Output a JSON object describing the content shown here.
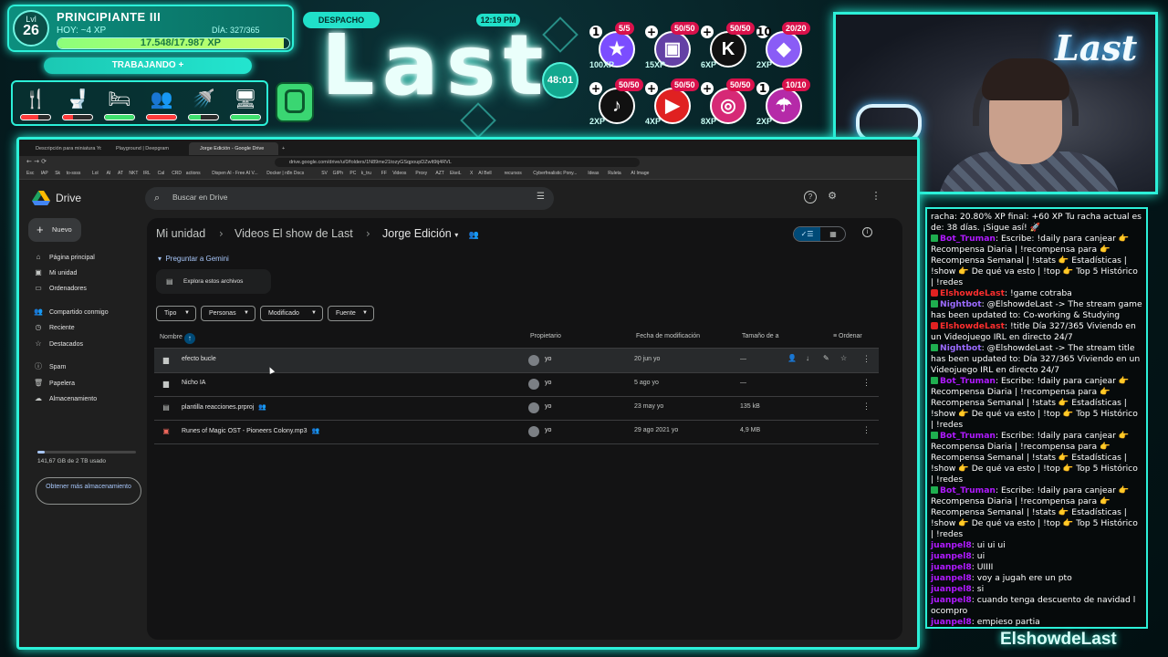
{
  "overlay": {
    "level": {
      "prefix": "Lvl",
      "number": "26",
      "title": "PRINCIPIANTE III",
      "today": "HOY: ~4 XP",
      "day": "DÍA: 327/365",
      "xp": "17.548/17.987 XP",
      "xp_fraction": 0.976
    },
    "status": "TRABAJANDO",
    "needs": [
      {
        "icon": "food-icon",
        "level": 0.6,
        "color": "#ff3b3b"
      },
      {
        "icon": "toilet-icon",
        "level": 0.35,
        "color": "#ff3b3b"
      },
      {
        "icon": "sleep-icon",
        "level": 1.0,
        "color": "#3fe06e"
      },
      {
        "icon": "social-icon",
        "level": 1.0,
        "color": "#ff3b3b"
      },
      {
        "icon": "shower-icon",
        "level": 0.4,
        "color": "#3fe06e"
      },
      {
        "icon": "fun-icon",
        "level": 1.0,
        "color": "#3fe06e"
      }
    ],
    "room": "DESPACHO",
    "clock": "12:19 PM",
    "logo_text": "Last",
    "timer": "48:01",
    "socials": [
      {
        "icon": "star-icon",
        "count": "5/5",
        "xp": "100XP",
        "pre": "1",
        "color": "#7b4dff"
      },
      {
        "icon": "twitch-icon",
        "count": "50/50",
        "xp": "15XP",
        "pre": "+",
        "color": "#6441a5"
      },
      {
        "icon": "kick-icon",
        "count": "50/50",
        "xp": "6XP",
        "pre": "+",
        "color": "#111"
      },
      {
        "icon": "ethereum-icon",
        "count": "20/20",
        "xp": "2XP",
        "pre": "10",
        "color": "#8a5cf6"
      },
      {
        "icon": "tiktok-icon",
        "count": "50/50",
        "xp": "2XP",
        "pre": "+",
        "color": "#111"
      },
      {
        "icon": "youtube-icon",
        "count": "50/50",
        "xp": "4XP",
        "pre": "+",
        "color": "#e02121"
      },
      {
        "icon": "instagram-icon",
        "count": "50/50",
        "xp": "8XP",
        "pre": "+",
        "color": "#d62976"
      },
      {
        "icon": "parachute-icon",
        "count": "10/10",
        "xp": "2XP",
        "pre": "1",
        "color": "#b52aa8"
      }
    ]
  },
  "browser": {
    "tabs": [
      "Descripción para miniatura YouTube",
      "Playground | Deepgram",
      "Jorge Edición - Google Drive"
    ],
    "url": "drive.google.com/drive/u/0/folders/1N89me21tozyGSqpoupDZwlt9tj4RVL",
    "bookmarks": [
      "Esc",
      "IAP",
      "Sk",
      "to-ssss",
      "Lol",
      "AI",
      "AT",
      "NKT",
      "IRL",
      "Cal",
      "CRD",
      "actions",
      "Dispen AI - Free AI V...",
      "Docker | n8n Docs",
      "SV",
      "GIPh",
      "PC",
      "k_tru",
      "FF",
      "Videos",
      "Proxy",
      "AZT",
      "EkeiL",
      "X",
      "AI Bell",
      "recursos",
      "Cyberfrealistic Pony...",
      "Ideas",
      "Ruleta",
      "AI Image"
    ]
  },
  "drive": {
    "app_name": "Drive",
    "search_placeholder": "Buscar en Drive",
    "new_label": "Nuevo",
    "nav": [
      {
        "icon": "home-icon",
        "label": "Página principal"
      },
      {
        "icon": "my-drive-icon",
        "label": "Mi unidad"
      },
      {
        "icon": "computers-icon",
        "label": "Ordenadores"
      },
      {
        "icon": "shared-icon",
        "label": "Compartido conmigo"
      },
      {
        "icon": "recent-icon",
        "label": "Reciente"
      },
      {
        "icon": "star-icon",
        "label": "Destacados"
      },
      {
        "icon": "spam-icon",
        "label": "Spam"
      },
      {
        "icon": "trash-icon",
        "label": "Papelera"
      },
      {
        "icon": "cloud-icon",
        "label": "Almacenamiento"
      }
    ],
    "storage_text": "141,67 GB de 2 TB usado",
    "storage_fraction": 0.07,
    "more_storage": "Obtener más almacenamiento",
    "breadcrumb": [
      "Mi unidad",
      "Videos El show de Last",
      "Jorge Edición"
    ],
    "gemini_label": "Preguntar a Gemini",
    "explore_label": "Explora estos archivos",
    "filters": [
      "Tipo",
      "Personas",
      "Modificado",
      "Fuente"
    ],
    "columns": {
      "name": "Nombre",
      "owner": "Propietario",
      "modified": "Fecha de modificación",
      "size": "Tamaño de a",
      "sort": "Ordenar"
    },
    "files": [
      {
        "icon": "folder-icon",
        "name": "efecto bucle",
        "shared": false,
        "owner": "yo",
        "modified": "20 jun yo",
        "size": "—"
      },
      {
        "icon": "folder-icon",
        "name": "Nicho IA",
        "shared": false,
        "owner": "yo",
        "modified": "5 ago yo",
        "size": "—"
      },
      {
        "icon": "project-file-icon",
        "name": "plantilla reacciones.prproj",
        "shared": true,
        "owner": "yo",
        "modified": "23 may yo",
        "size": "135 kB"
      },
      {
        "icon": "audio-file-icon",
        "name": "Runes of Magic OST - Pioneers Colony.mp3",
        "shared": true,
        "owner": "yo",
        "modified": "29 ago 2021 yo",
        "size": "4,9 MB"
      }
    ]
  },
  "chat": {
    "messages": [
      {
        "user": "",
        "color": "#ffffff",
        "text": "racha: 20.80% XP final: +60 XP Tu racha actual es de: 38 días. ¡Sigue así! 🚀"
      },
      {
        "user": "Bot_Truman",
        "color": "#b01aff",
        "badge": "chk",
        "text": ": Escribe: !daily para canjear 👉 Recompensa Diaria | !recompensa para 👉 Recompensa Semanal | !stats 👉 Estadísticas | !show 👉 De qué va esto | !top 👉 Top 5 Histórico | !redes"
      },
      {
        "user": "ElshowdeLast",
        "color": "#ff2e2e",
        "badge": "yt",
        "text": ": !game cotraba"
      },
      {
        "user": "Nightbot",
        "color": "#9b6bff",
        "badge": "chk",
        "text": ": @ElshowdeLast -> The stream game has been updated to: Co-working & Studying"
      },
      {
        "user": "ElshowdeLast",
        "color": "#ff2e2e",
        "badge": "yt",
        "text": ": !title Día 327/365 Viviendo en un Videojuego IRL en directo 24/7"
      },
      {
        "user": "Nightbot",
        "color": "#9b6bff",
        "badge": "chk",
        "text": ": @ElshowdeLast -> The stream title has been updated to: Día 327/365 Viviendo en un Videojuego IRL en directo 24/7"
      },
      {
        "user": "Bot_Truman",
        "color": "#b01aff",
        "badge": "chk",
        "text": ": Escribe: !daily para canjear 👉 Recompensa Diaria | !recompensa para 👉 Recompensa Semanal | !stats 👉 Estadísticas | !show 👉 De qué va esto | !top 👉 Top 5 Histórico | !redes"
      },
      {
        "user": "Bot_Truman",
        "color": "#b01aff",
        "badge": "chk",
        "text": ": Escribe: !daily para canjear 👉 Recompensa Diaria | !recompensa para 👉 Recompensa Semanal | !stats 👉 Estadísticas | !show 👉 De qué va esto | !top 👉 Top 5 Histórico | !redes"
      },
      {
        "user": "Bot_Truman",
        "color": "#b01aff",
        "badge": "chk",
        "text": ": Escribe: !daily para canjear 👉 Recompensa Diaria | !recompensa para 👉 Recompensa Semanal | !stats 👉 Estadísticas | !show 👉 De qué va esto | !top 👉 Top 5 Histórico | !redes"
      },
      {
        "user": "juanpel8",
        "color": "#b01aff",
        "text": ": ui ui ui"
      },
      {
        "user": "juanpel8",
        "color": "#b01aff",
        "text": ": ui"
      },
      {
        "user": "juanpel8",
        "color": "#b01aff",
        "text": ": UIIII"
      },
      {
        "user": "juanpel8",
        "color": "#b01aff",
        "text": ": voy a jugah ere un pto"
      },
      {
        "user": "juanpel8",
        "color": "#b01aff",
        "text": ": si"
      },
      {
        "user": "juanpel8",
        "color": "#b01aff",
        "text": ": cuando tenga descuento de navidad l ocompro"
      },
      {
        "user": "juanpel8",
        "color": "#b01aff",
        "text": ": empieso partia"
      }
    ],
    "channel": "ElshowdeLast"
  },
  "cam": {
    "neon_text": "Last"
  }
}
